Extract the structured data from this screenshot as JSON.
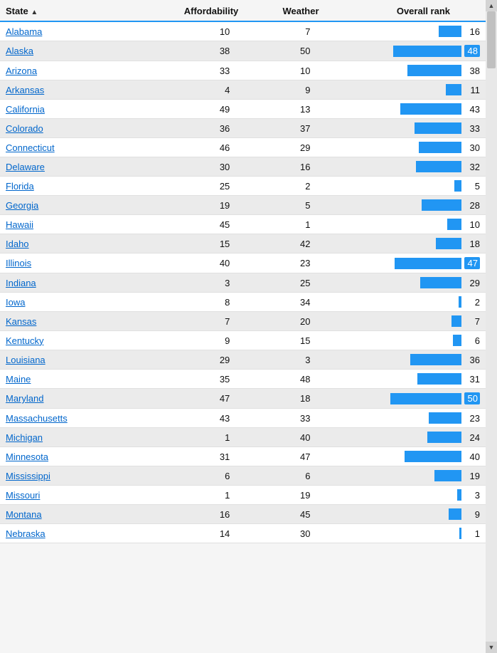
{
  "header": {
    "state_label": "State",
    "affordability_label": "Affordability",
    "weather_label": "Weather",
    "overall_rank_label": "Overall rank"
  },
  "rows": [
    {
      "state": "Alabama",
      "affordability": 10,
      "weather": 7,
      "rank": 16,
      "highlight": false
    },
    {
      "state": "Alaska",
      "affordability": 38,
      "weather": 50,
      "rank": 48,
      "highlight": true
    },
    {
      "state": "Arizona",
      "affordability": 33,
      "weather": 10,
      "rank": 38,
      "highlight": false
    },
    {
      "state": "Arkansas",
      "affordability": 4,
      "weather": 9,
      "rank": 11,
      "highlight": false
    },
    {
      "state": "California",
      "affordability": 49,
      "weather": 13,
      "rank": 43,
      "highlight": false
    },
    {
      "state": "Colorado",
      "affordability": 36,
      "weather": 37,
      "rank": 33,
      "highlight": false
    },
    {
      "state": "Connecticut",
      "affordability": 46,
      "weather": 29,
      "rank": 30,
      "highlight": false
    },
    {
      "state": "Delaware",
      "affordability": 30,
      "weather": 16,
      "rank": 32,
      "highlight": false
    },
    {
      "state": "Florida",
      "affordability": 25,
      "weather": 2,
      "rank": 5,
      "highlight": false
    },
    {
      "state": "Georgia",
      "affordability": 19,
      "weather": 5,
      "rank": 28,
      "highlight": false
    },
    {
      "state": "Hawaii",
      "affordability": 45,
      "weather": 1,
      "rank": 10,
      "highlight": false
    },
    {
      "state": "Idaho",
      "affordability": 15,
      "weather": 42,
      "rank": 18,
      "highlight": false
    },
    {
      "state": "Illinois",
      "affordability": 40,
      "weather": 23,
      "rank": 47,
      "highlight": true
    },
    {
      "state": "Indiana",
      "affordability": 3,
      "weather": 25,
      "rank": 29,
      "highlight": false
    },
    {
      "state": "Iowa",
      "affordability": 8,
      "weather": 34,
      "rank": 2,
      "highlight": false
    },
    {
      "state": "Kansas",
      "affordability": 7,
      "weather": 20,
      "rank": 7,
      "highlight": false
    },
    {
      "state": "Kentucky",
      "affordability": 9,
      "weather": 15,
      "rank": 6,
      "highlight": false
    },
    {
      "state": "Louisiana",
      "affordability": 29,
      "weather": 3,
      "rank": 36,
      "highlight": false
    },
    {
      "state": "Maine",
      "affordability": 35,
      "weather": 48,
      "rank": 31,
      "highlight": false
    },
    {
      "state": "Maryland",
      "affordability": 47,
      "weather": 18,
      "rank": 50,
      "highlight": true
    },
    {
      "state": "Massachusetts",
      "affordability": 43,
      "weather": 33,
      "rank": 23,
      "highlight": false
    },
    {
      "state": "Michigan",
      "affordability": 1,
      "weather": 40,
      "rank": 24,
      "highlight": false
    },
    {
      "state": "Minnesota",
      "affordability": 31,
      "weather": 47,
      "rank": 40,
      "highlight": false
    },
    {
      "state": "Mississippi",
      "affordability": 6,
      "weather": 6,
      "rank": 19,
      "highlight": false
    },
    {
      "state": "Missouri",
      "affordability": 1,
      "weather": 19,
      "rank": 3,
      "highlight": false
    },
    {
      "state": "Montana",
      "affordability": 16,
      "weather": 45,
      "rank": 9,
      "highlight": false
    },
    {
      "state": "Nebraska",
      "affordability": 14,
      "weather": 30,
      "rank": 1,
      "highlight": false
    }
  ],
  "max_rank": 50
}
